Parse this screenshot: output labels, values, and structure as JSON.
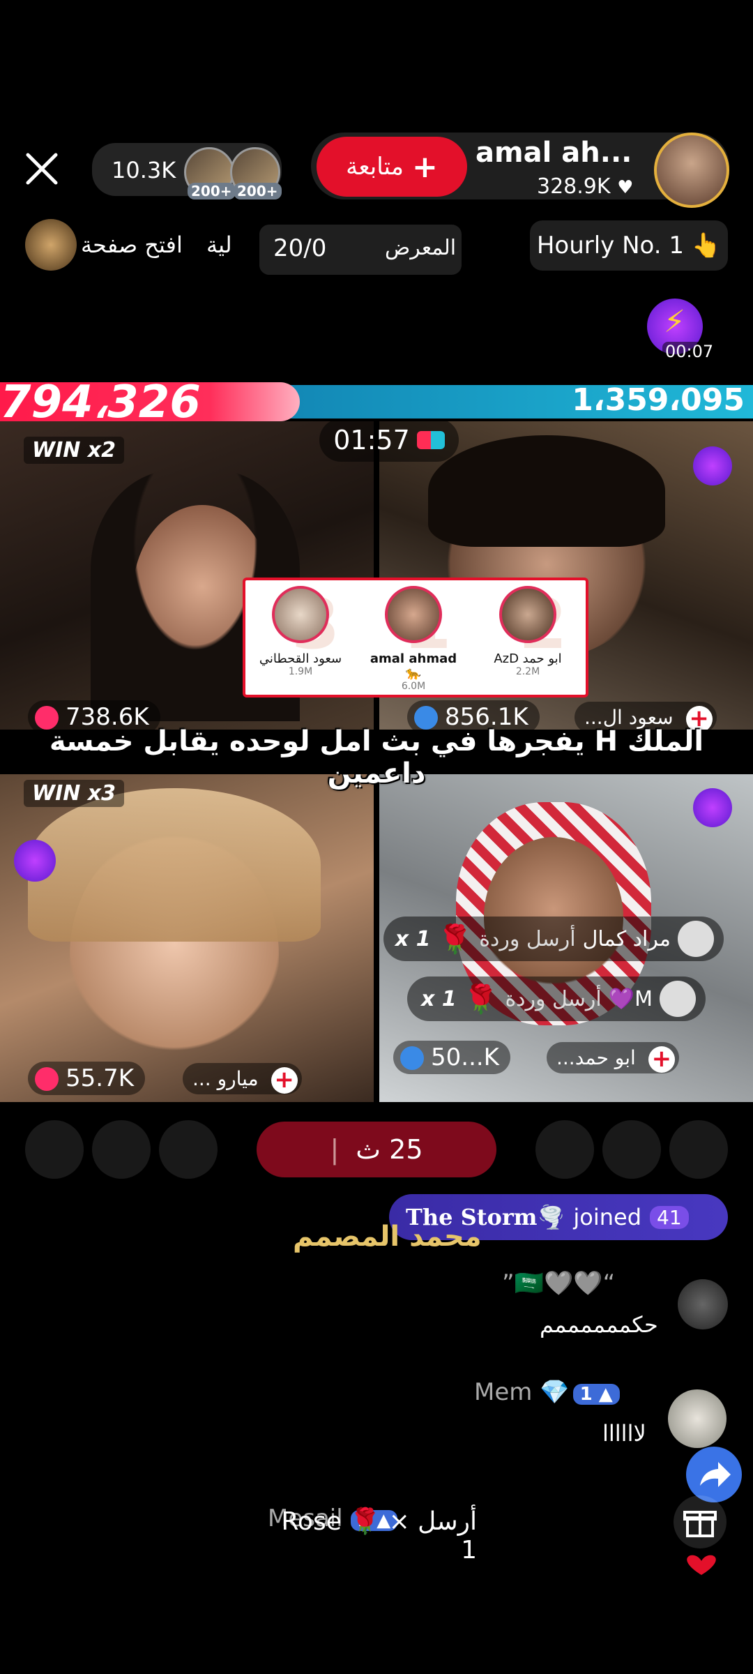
{
  "top_bar": {
    "viewer_count": "10.3K",
    "viewer_badge_1": "200+",
    "viewer_badge_2": "200+",
    "follow_label": "متابعة",
    "host_name": "amal ah...",
    "host_likes": "328.9K"
  },
  "second_row": {
    "open_page_text": "افتح صفحة",
    "open_page_suffix": "لية",
    "gallery_count": "20/0",
    "gallery_label": "المعرض",
    "hourly_label": "Hourly No. 1 👆",
    "boost_timer": "00:07"
  },
  "battle": {
    "left_score": "794،326",
    "right_score": "1،359،095",
    "timer": "01:57"
  },
  "tiles": {
    "t1": {
      "win": "WIN x2",
      "stat": "738.6K"
    },
    "t2": {
      "stat": "856.1K",
      "name": "سعود ال..."
    },
    "t3": {
      "win": "WIN x3",
      "stat": "55.7K",
      "name": "ميارو ..."
    },
    "t4": {
      "stat": "50...K",
      "name": "ابو حمد..."
    }
  },
  "ranking": [
    {
      "rank": "3",
      "name": "سعود القحطاني",
      "value": "1.9M"
    },
    {
      "rank": "1",
      "name": "amal ahmad 🐆",
      "value": "6.0M"
    },
    {
      "rank": "2",
      "name": "ابو حمد AzD",
      "value": "2.2M"
    }
  ],
  "caption": "الملك H يفجرها في بث امل لوحده يقابل خمسة داعمين",
  "gifts": [
    {
      "sender": "مراد كمال",
      "action": "أرسل وردة",
      "count": "1 x"
    },
    {
      "sender": "M💜",
      "action": "أرسل وردة",
      "count": "1 x"
    }
  ],
  "countdown": {
    "value": "25 ث"
  },
  "joined": {
    "name": "The Storm🌪️",
    "text": "joined",
    "level": "41"
  },
  "watermark": "محمد المصمم",
  "chat": [
    {
      "name": "”🇸🇦🩶🩶“",
      "message": "حكممممممم"
    },
    {
      "name": "Mem 💎",
      "level": "1",
      "message": "لاااااا"
    },
    {
      "name": "Mesail",
      "level": "2",
      "message": "أرسل Rose 🌹 × 1"
    }
  ],
  "colors": {
    "accent_red": "#e3102a",
    "score_blue": "#1a8fc0",
    "joined_purple": "#3a2ba6"
  }
}
